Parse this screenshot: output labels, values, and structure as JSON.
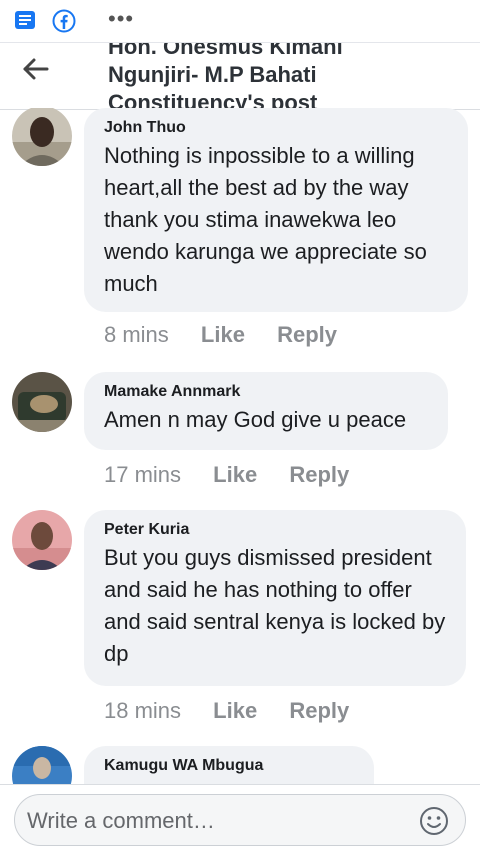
{
  "header": {
    "title_lines": [
      "Hon. Onesmus Kimani",
      "Ngunjiri- M.P Bahati",
      "Constituency's post"
    ]
  },
  "comments": [
    {
      "author": "John Thuo",
      "text": "Nothing is inpossible to a willing heart,all the best ad by the way thank you stima inawekwa leo wendo karunga we appreciate so much",
      "time": "8 mins",
      "like": "Like",
      "reply": "Reply"
    },
    {
      "author": "Mamake Annmark",
      "text": "Amen n may God give u peace",
      "time": "17 mins",
      "like": "Like",
      "reply": "Reply"
    },
    {
      "author": "Peter Kuria",
      "text": "But you guys dismissed president and said he has nothing to offer and said sentral kenya is locked by dp",
      "time": "18 mins",
      "like": "Like",
      "reply": "Reply"
    },
    {
      "author": "Kamugu WA Mbugua"
    }
  ],
  "composer": {
    "placeholder": "Write a comment…"
  },
  "colors": {
    "facebook_blue": "#1877f2",
    "bubble_bg": "#f0f2f5",
    "meta_gray": "#8a8d91"
  }
}
